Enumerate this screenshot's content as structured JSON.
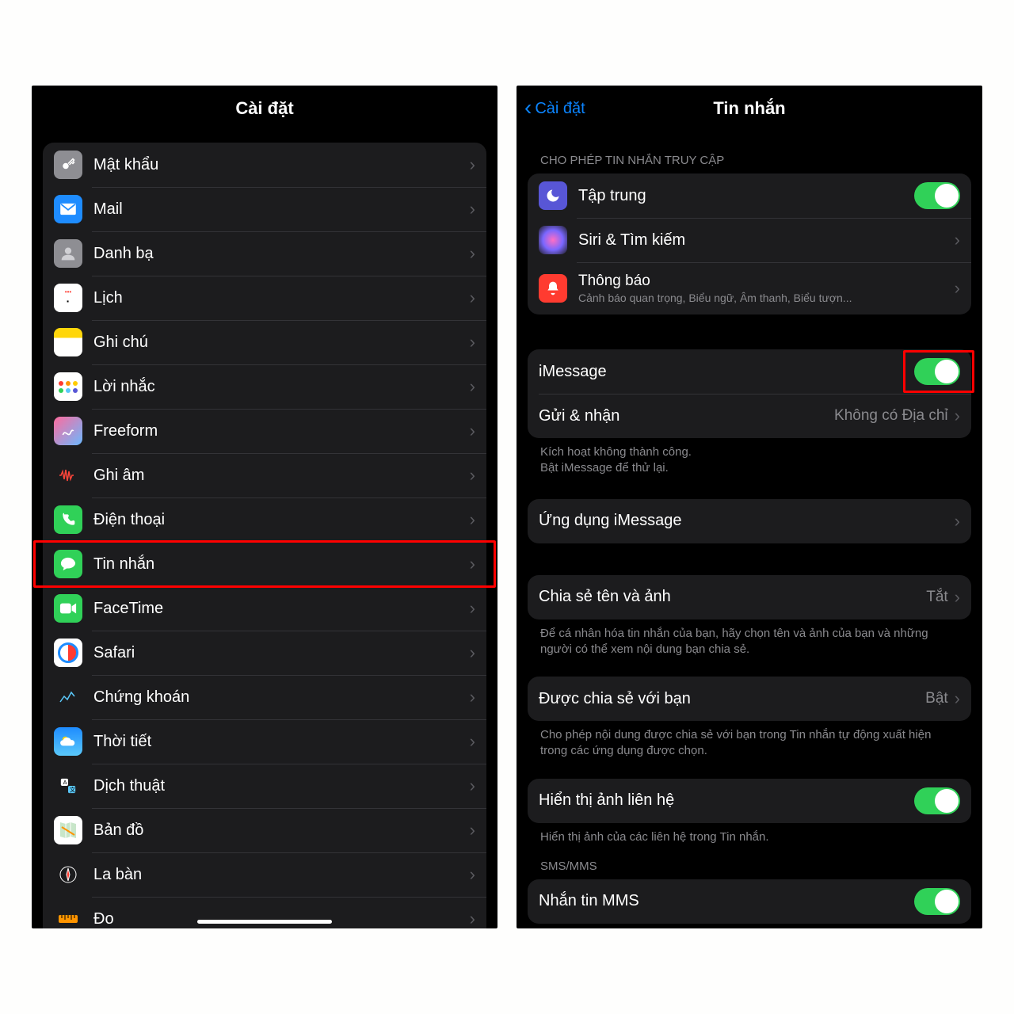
{
  "left": {
    "title": "Cài đặt",
    "items": [
      {
        "label": "Mật khẩu",
        "icon": "passwords"
      },
      {
        "label": "Mail",
        "icon": "mail"
      },
      {
        "label": "Danh bạ",
        "icon": "contacts"
      },
      {
        "label": "Lịch",
        "icon": "calendar"
      },
      {
        "label": "Ghi chú",
        "icon": "notes"
      },
      {
        "label": "Lời nhắc",
        "icon": "reminders"
      },
      {
        "label": "Freeform",
        "icon": "freeform"
      },
      {
        "label": "Ghi âm",
        "icon": "voicememo"
      },
      {
        "label": "Điện thoại",
        "icon": "phone"
      },
      {
        "label": "Tin nhắn",
        "icon": "messages",
        "highlighted": true
      },
      {
        "label": "FaceTime",
        "icon": "facetime"
      },
      {
        "label": "Safari",
        "icon": "safari"
      },
      {
        "label": "Chứng khoán",
        "icon": "stocks"
      },
      {
        "label": "Thời tiết",
        "icon": "weather"
      },
      {
        "label": "Dịch thuật",
        "icon": "translate"
      },
      {
        "label": "Bản đồ",
        "icon": "maps"
      },
      {
        "label": "La bàn",
        "icon": "compass"
      },
      {
        "label": "Đo",
        "icon": "measure"
      }
    ]
  },
  "right": {
    "back": "Cài đặt",
    "title": "Tin nhắn",
    "section_access_header": "CHO PHÉP TIN NHẮN TRUY CẬP",
    "access": {
      "focus": "Tập trung",
      "siri": "Siri & Tìm kiếm",
      "notif": "Thông báo",
      "notif_sub": "Cảnh báo quan trọng, Biểu ngữ, Âm thanh, Biểu tượn..."
    },
    "imessage": {
      "label": "iMessage",
      "send_receive": "Gửi & nhận",
      "send_receive_value": "Không có Địa chỉ",
      "footer1": "Kích hoạt không thành công.",
      "footer2": "Bật iMessage để thử lại."
    },
    "imessage_apps": "Ứng dụng iMessage",
    "share_name": {
      "label": "Chia sẻ tên và ảnh",
      "value": "Tắt",
      "footer": "Để cá nhân hóa tin nhắn của bạn, hãy chọn tên và ảnh của bạn và những người có thể xem nội dung bạn chia sẻ."
    },
    "shared_with_you": {
      "label": "Được chia sẻ với bạn",
      "value": "Bật",
      "footer": "Cho phép nội dung được chia sẻ với bạn trong Tin nhắn tự động xuất hiện trong các ứng dụng được chọn."
    },
    "contact_photos": {
      "label": "Hiển thị ảnh liên hệ",
      "footer": "Hiển thị ảnh của các liên hệ trong Tin nhắn."
    },
    "sms_header": "SMS/MMS",
    "mms": "Nhắn tin MMS"
  }
}
